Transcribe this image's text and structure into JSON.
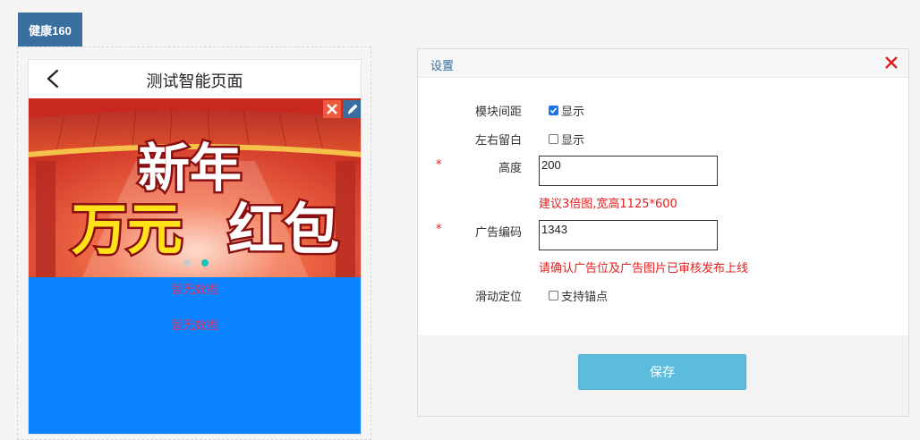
{
  "tab": {
    "label": "健康160"
  },
  "phone": {
    "title": "测试智能页面",
    "banner": {
      "line1": "新年",
      "line2_highlight": "万元",
      "line2_rest": "红包",
      "dots_total": 2,
      "active_dot": 2
    },
    "empty_1": "暂无数据",
    "empty_2": "暂无数据"
  },
  "panel": {
    "title": "设置",
    "module_spacing": {
      "label": "模块间距",
      "option": "显示",
      "checked": true
    },
    "side_margin": {
      "label": "左右留白",
      "option": "显示",
      "checked": false
    },
    "height": {
      "required": "*",
      "label": "高度",
      "value": "200",
      "hint": "建议3倍图,宽高1125*600"
    },
    "ad_code": {
      "required": "*",
      "label": "广告编码",
      "value": "1343",
      "hint": "请确认广告位及广告图片已审核发布上线"
    },
    "scroll_anchor": {
      "label": "滑动定位",
      "option": "支持锚点",
      "checked": false
    },
    "save_label": "保存"
  },
  "colors": {
    "tab_bg": "#3a6e9f",
    "save_bg": "#5bbcdc",
    "hint": "#e02020",
    "blue_area": "#0983ff",
    "empty_text": "#e0386a"
  }
}
